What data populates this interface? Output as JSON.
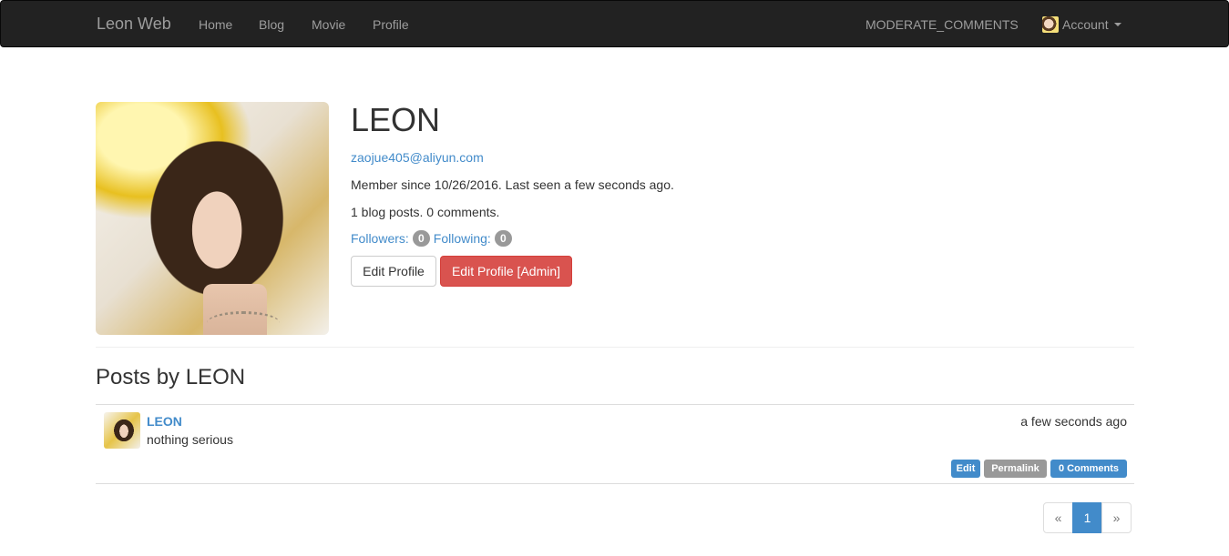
{
  "navbar": {
    "brand": "Leon Web",
    "links": [
      "Home",
      "Blog",
      "Movie",
      "Profile"
    ],
    "moderate": "MODERATE_COMMENTS",
    "account": "Account"
  },
  "profile": {
    "name": "LEON",
    "email": "zaojue405@aliyun.com",
    "member_line": "Member since 10/26/2016. Last seen a few seconds ago.",
    "stats_line": "1 blog posts. 0 comments.",
    "followers_label": "Followers:",
    "followers_count": "0",
    "following_label": "Following:",
    "following_count": "0",
    "edit_button": "Edit Profile",
    "admin_button": "Edit Profile [Admin]"
  },
  "posts": {
    "heading": "Posts by LEON",
    "items": [
      {
        "author": "LEON",
        "body": "nothing serious",
        "date": "a few seconds ago",
        "edit": "Edit",
        "permalink": "Permalink",
        "comments": "0 Comments"
      }
    ]
  },
  "pagination": {
    "prev": "«",
    "current": "1",
    "next": "»"
  },
  "colors": {
    "navbar_bg": "#222222",
    "link": "#428bca",
    "danger": "#d9534f",
    "badge": "#999999"
  }
}
